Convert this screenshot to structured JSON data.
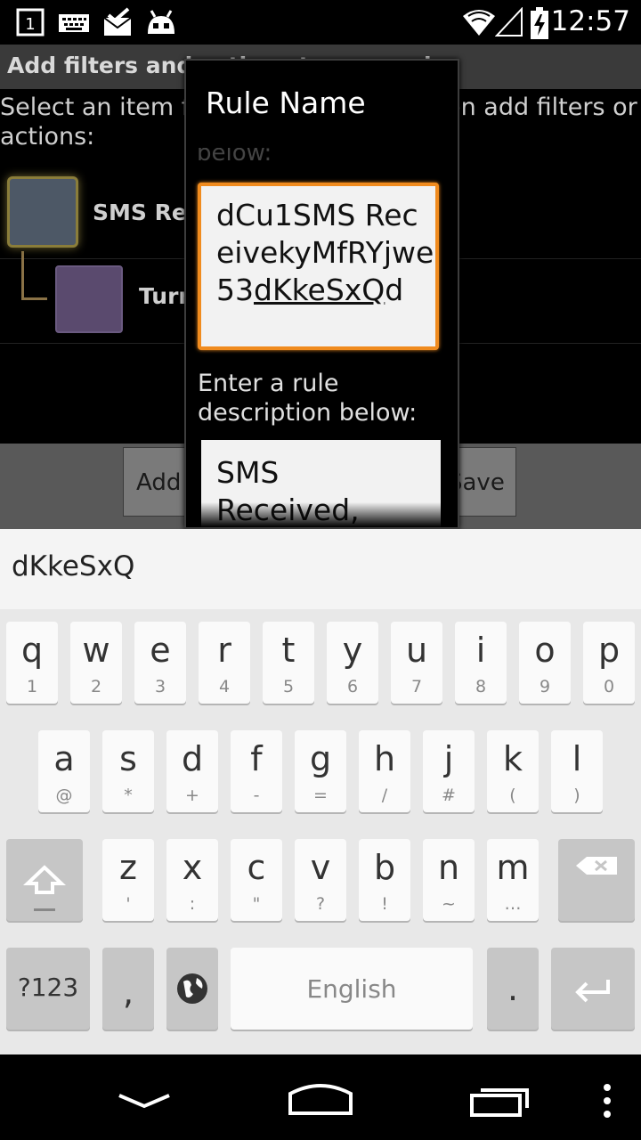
{
  "status_bar": {
    "time": "12:57",
    "left_icons": [
      "notification-1-icon",
      "keyboard-icon",
      "mail-icon",
      "android-icon"
    ],
    "right_icons": [
      "wifi-icon",
      "signal-icon",
      "battery-charging-icon"
    ],
    "notification_number": "1"
  },
  "background_app": {
    "title": "Add filters and actions to your rule",
    "instructions": "Select an item from the list below, then add filters or actions:",
    "tree": [
      {
        "label": "SMS Received"
      },
      {
        "label": "Turn"
      }
    ],
    "buttons": {
      "add": "Add F",
      "save": "Save"
    }
  },
  "dialog": {
    "title": "Rule Name",
    "hidden_hint": "below:",
    "name_value_plain": "dCu1SMS ReceivekyMfRYjwe53",
    "name_value_composing": "dKkeSxQ",
    "name_value_tail": "d",
    "description_label": "Enter a rule description below:",
    "description_value": "SMS Received, Turn"
  },
  "suggestion": "dKkeSxQ",
  "keyboard": {
    "row1": [
      {
        "k": "q",
        "s": "1"
      },
      {
        "k": "w",
        "s": "2"
      },
      {
        "k": "e",
        "s": "3"
      },
      {
        "k": "r",
        "s": "4"
      },
      {
        "k": "t",
        "s": "5"
      },
      {
        "k": "y",
        "s": "6"
      },
      {
        "k": "u",
        "s": "7"
      },
      {
        "k": "i",
        "s": "8"
      },
      {
        "k": "o",
        "s": "9"
      },
      {
        "k": "p",
        "s": "0"
      }
    ],
    "row2": [
      {
        "k": "a",
        "s": "@"
      },
      {
        "k": "s",
        "s": "*"
      },
      {
        "k": "d",
        "s": "+"
      },
      {
        "k": "f",
        "s": "-"
      },
      {
        "k": "g",
        "s": "="
      },
      {
        "k": "h",
        "s": "/"
      },
      {
        "k": "j",
        "s": "#"
      },
      {
        "k": "k",
        "s": "("
      },
      {
        "k": "l",
        "s": ")"
      }
    ],
    "row3": [
      {
        "k": "z",
        "s": "'"
      },
      {
        "k": "x",
        "s": ":"
      },
      {
        "k": "c",
        "s": "\""
      },
      {
        "k": "v",
        "s": "?"
      },
      {
        "k": "b",
        "s": "!"
      },
      {
        "k": "n",
        "s": "~"
      },
      {
        "k": "m",
        "s": "…"
      }
    ],
    "symbols_key": "?123",
    "comma": ",",
    "space_label": "English",
    "period": "."
  },
  "nav_bar": [
    "back-icon",
    "home-icon",
    "recents-icon",
    "menu-icon"
  ],
  "colors": {
    "accent": "#f08b1e",
    "dialog_bg": "#000000",
    "keyboard_bg": "#e8e8e8"
  }
}
